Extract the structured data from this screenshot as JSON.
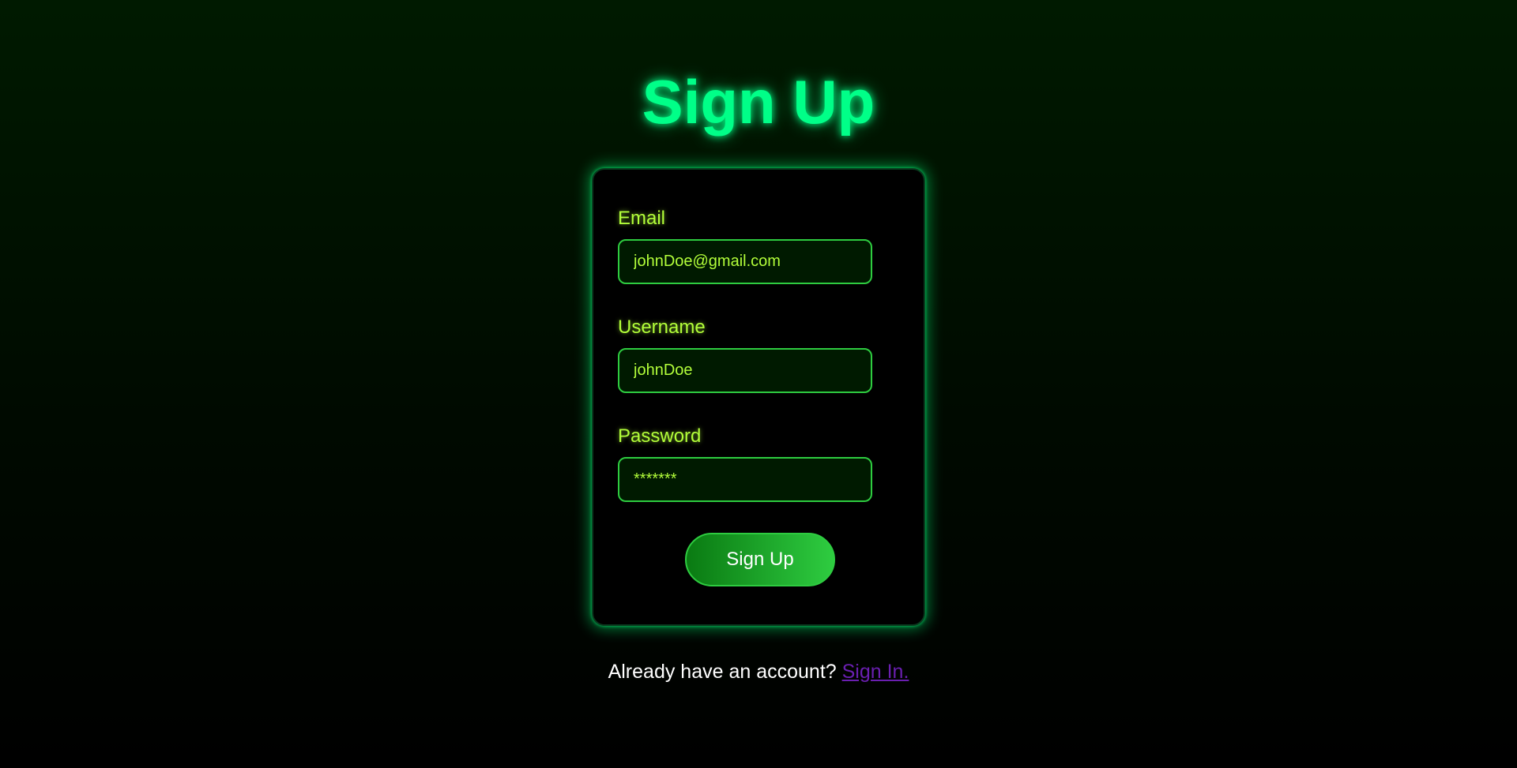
{
  "header": {
    "title": "Sign Up"
  },
  "form": {
    "email": {
      "label": "Email",
      "value": "johnDoe@gmail.com"
    },
    "username": {
      "label": "Username",
      "value": "johnDoe"
    },
    "password": {
      "label": "Password",
      "value": "*******"
    },
    "submit_label": "Sign Up"
  },
  "footer": {
    "prompt": "Already have an account? ",
    "link_label": "Sign In."
  },
  "colors": {
    "title": "#00ff88",
    "label": "#b3ff3a",
    "input_border": "#2ecc40",
    "link": "#6a1fb0"
  }
}
